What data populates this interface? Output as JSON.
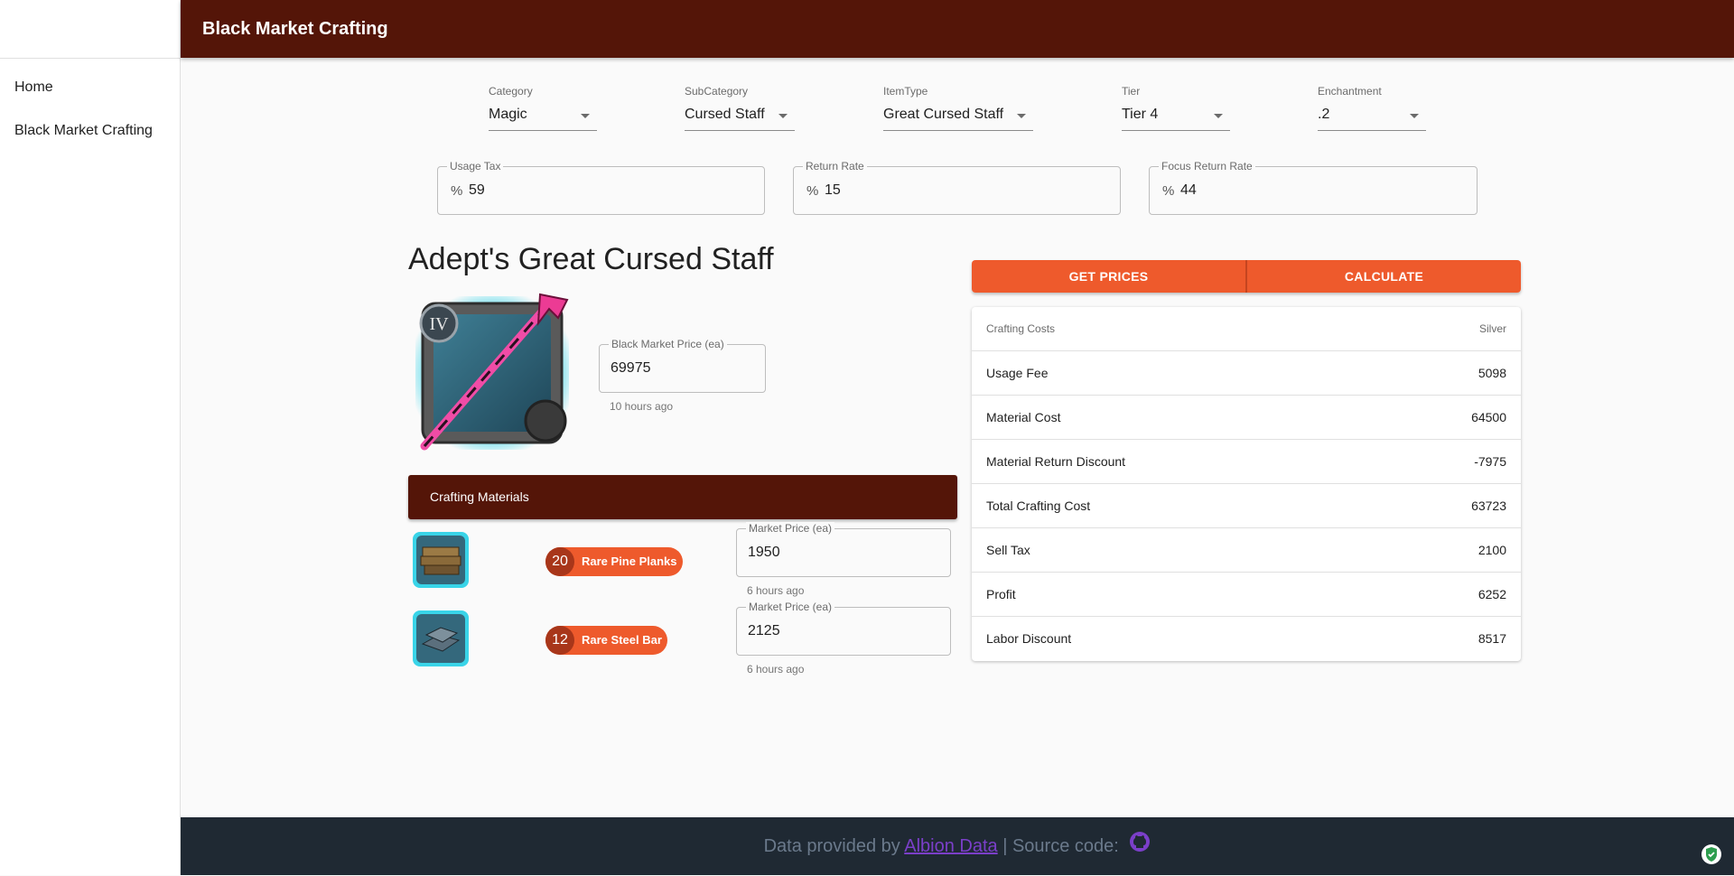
{
  "sidebar": {
    "items": [
      {
        "label": "Home"
      },
      {
        "label": "Black Market Crafting"
      }
    ]
  },
  "header": {
    "title": "Black Market Crafting"
  },
  "filters": {
    "category": {
      "label": "Category",
      "value": "Magic"
    },
    "subcategory": {
      "label": "SubCategory",
      "value": "Cursed Staff"
    },
    "itemtype": {
      "label": "ItemType",
      "value": "Great Cursed Staff"
    },
    "tier": {
      "label": "Tier",
      "value": "Tier 4"
    },
    "enchantment": {
      "label": "Enchantment",
      "value": ".2"
    }
  },
  "rates": {
    "usage_tax": {
      "label": "Usage Tax",
      "prefix": "%",
      "value": "59"
    },
    "return_rate": {
      "label": "Return Rate",
      "prefix": "%",
      "value": "15"
    },
    "focus_return_rate": {
      "label": "Focus Return Rate",
      "prefix": "%",
      "value": "44"
    }
  },
  "item": {
    "title": "Adept's Great Cursed Staff",
    "tier_badge": "IV",
    "bm_price": {
      "label": "Black Market Price (ea)",
      "value": "69975",
      "updated": "10 hours ago"
    }
  },
  "materials": {
    "header": "Crafting Materials",
    "items": [
      {
        "count": "20",
        "name": "Rare Pine Planks",
        "price_label": "Market Price (ea)",
        "price": "1950",
        "updated": "6 hours ago"
      },
      {
        "count": "12",
        "name": "Rare Steel Bar",
        "price_label": "Market Price (ea)",
        "price": "2125",
        "updated": "6 hours ago"
      }
    ]
  },
  "actions": {
    "get_prices": "GET PRICES",
    "calculate": "CALCULATE"
  },
  "costs": {
    "head_left": "Crafting Costs",
    "head_right": "Silver",
    "rows": [
      {
        "label": "Usage Fee",
        "value": "5098"
      },
      {
        "label": "Material Cost",
        "value": "64500"
      },
      {
        "label": "Material Return Discount",
        "value": "-7975"
      },
      {
        "label": "Total Crafting Cost",
        "value": "63723"
      },
      {
        "label": "Sell Tax",
        "value": "2100"
      },
      {
        "label": "Profit",
        "value": "6252"
      },
      {
        "label": "Labor Discount",
        "value": "8517"
      }
    ]
  },
  "footer": {
    "prefix": "Data provided by",
    "link": "Albion Data",
    "suffix": "| Source code:",
    "icon": "github-icon"
  },
  "colors": {
    "brand": "#541508",
    "accent": "#ee5a2c",
    "footer_bg": "#1f2933",
    "link": "#7b3fc9"
  }
}
